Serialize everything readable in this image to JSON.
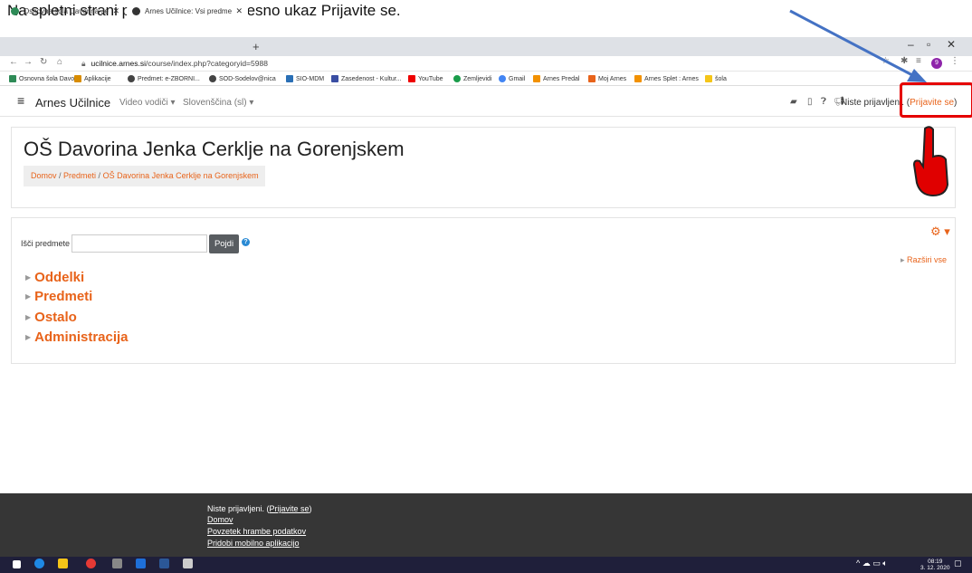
{
  "annotation": {
    "text": "Na spletni strani poiščemo zgoraj desno ukaz Prijavite se."
  },
  "browser": {
    "tabs": [
      {
        "title": "Osnovna šola Davorina Jenka – C"
      },
      {
        "title": "Arnes Učilnice: Vsi predmeti"
      }
    ],
    "url_host": "ucilnice.arnes.si",
    "url_path": "/course/index.php?categoryid=5988",
    "avatar_letter": "9",
    "bookmarks": [
      "Osnovna šola Davo...",
      "Aplikacije",
      "Predmet: e-ZBORNI...",
      "SOD-Sodelov@nica",
      "SIO-MDM",
      "Zasedenost - Kultur...",
      "YouTube",
      "Zemljevidi",
      "Gmail",
      "Arnes Predal",
      "Moj Arnes",
      "Arnes Splet : Arnes",
      "šola"
    ]
  },
  "navbar": {
    "brand": "Arnes Učilnice",
    "video": "Video vodiči",
    "language": "Slovenščina (sl)",
    "not_logged": "Niste prijavljeni.",
    "login": "Prijavite se"
  },
  "header": {
    "title": "OŠ Davorina Jenka Cerklje na Gorenjskem",
    "crumb_home": "Domov",
    "crumb_courses": "Predmeti",
    "crumb_current": "OŠ Davorina Jenka Cerklje na Gorenjskem"
  },
  "main": {
    "search_label": "Išči predmete",
    "search_button": "Pojdi",
    "expand_all": "Razširi vse",
    "categories": [
      "Oddelki",
      "Predmeti",
      "Ostalo",
      "Administracija"
    ]
  },
  "footer": {
    "not_logged": "Niste prijavljeni.",
    "login": "Prijavite se",
    "home": "Domov",
    "data_summary": "Povzetek hrambe podatkov",
    "mobile_app": "Pridobi mobilno aplikacijo"
  },
  "taskbar": {
    "time": "08:19",
    "date": "3. 12. 2020"
  },
  "colors": {
    "accent": "#e8631a",
    "highlight": "#e50000",
    "arrow": "#4472c4"
  }
}
